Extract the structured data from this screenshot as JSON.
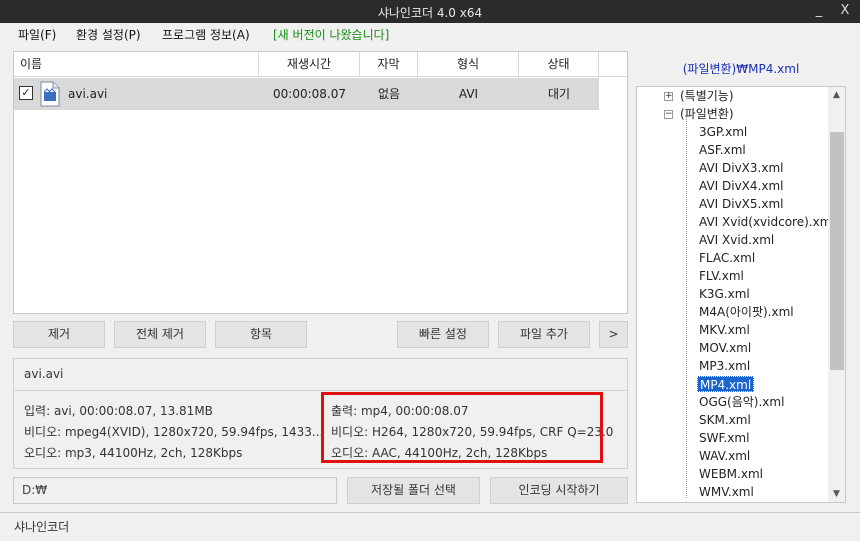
{
  "window": {
    "title": "샤나인코더 4.0 x64",
    "minimize_glyph": "_",
    "close_glyph": "X"
  },
  "menu": {
    "file": "파일(F)",
    "settings": "환경 설정(P)",
    "about": "프로그램 정보(A)",
    "update_notice": "[새 버전이 나왔습니다]"
  },
  "filelist": {
    "columns": [
      "이름",
      "재생시간",
      "자막",
      "형식",
      "상태"
    ],
    "rows": [
      {
        "checked": "✓",
        "name": "avi.avi",
        "duration": "00:00:08.07",
        "subtitle": "없음",
        "format": "AVI",
        "status": "대기"
      }
    ]
  },
  "buttons": {
    "remove": "제거",
    "remove_all": "전체 제거",
    "items": "항목",
    "quick_settings": "빠른 설정",
    "add_file": "파일 추가",
    "more": ">",
    "choose_folder": "저장될 폴더 선택",
    "start_encoding": "인코딩 시작하기"
  },
  "info": {
    "filename": "avi.avi",
    "input": "입력: avi, 00:00:08.07, 13.81MB",
    "input_video": "비디오: mpeg4(XVID), 1280x720, 59.94fps, 1433...",
    "input_audio": "오디오: mp3, 44100Hz, 2ch, 128Kbps",
    "output": "출력: mp4, 00:00:08.07",
    "output_video": "비디오: H264, 1280x720, 59.94fps, CRF Q=23.0",
    "output_audio": "오디오: AAC, 44100Hz, 2ch, 128Kbps"
  },
  "output_path": "D:₩",
  "statusbar": {
    "text": "샤나인코더"
  },
  "preset": {
    "current": "(파일변환)₩MP4.xml",
    "groups": [
      {
        "label": "(특별기능)",
        "expanded": false,
        "toggle": "+"
      },
      {
        "label": "(파일변환)",
        "expanded": true,
        "toggle": "−"
      }
    ],
    "items": [
      "3GP.xml",
      "ASF.xml",
      "AVI DivX3.xml",
      "AVI DivX4.xml",
      "AVI DivX5.xml",
      "AVI Xvid(xvidcore).xml",
      "AVI Xvid.xml",
      "FLAC.xml",
      "FLV.xml",
      "K3G.xml",
      "M4A(아이팟).xml",
      "MKV.xml",
      "MOV.xml",
      "MP3.xml",
      "MP4.xml",
      "OGG(음악).xml",
      "SKM.xml",
      "SWF.xml",
      "WAV.xml",
      "WEBM.xml",
      "WMV.xml"
    ],
    "selected": "MP4.xml"
  },
  "colors": {
    "highlight": "#e01010",
    "selection": "#1a64d0",
    "notice": "#1a8f1a",
    "preset_label": "#1c2fb5"
  },
  "icons": {
    "file": "video-file-icon",
    "scroll_up": "▲",
    "scroll_down": "▼"
  }
}
